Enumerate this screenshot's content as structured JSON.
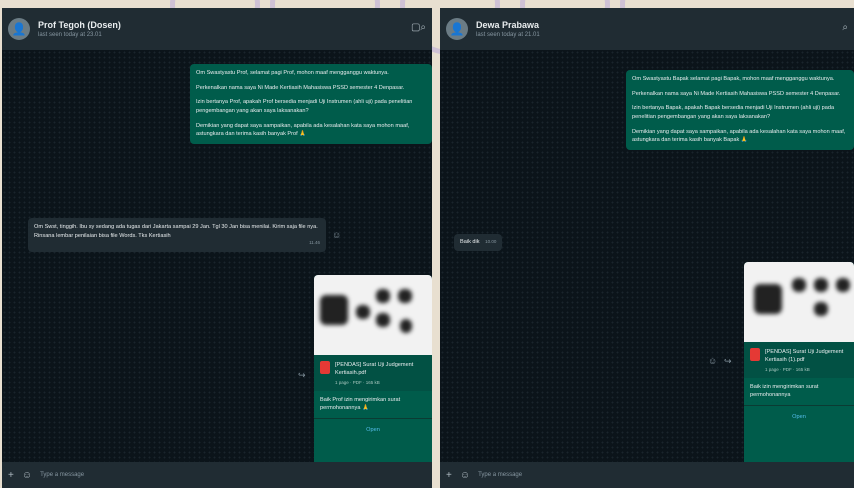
{
  "left": {
    "header": {
      "name": "Prof Tegoh (Dosen)",
      "status": "last seen today at 23.01"
    },
    "outgoing": {
      "p1": "Om Swastyastu Prof, selamat pagi Prof, mohon maaf mengganggu waktunya.",
      "p2": "Perkenalkan nama saya Ni Made Kertiasih Mahasiswa PSSD semester 4 Denpasar.",
      "p3": "Izin bertanya Prof, apakah Prof bersedia menjadi Uji Instrumen (ahli uji) pada penelitian pengembangan yang akan saya laksanakan?",
      "p4": "Demikian yang dapat saya sampaikan, apabila ada kesalahan kata saya mohon maaf, astungkara dan terima kasih banyak Prof 🙏"
    },
    "incoming": {
      "text": "Om Swst, tinggih. Ibu sy sedang ada tugas dari Jakarta sampai 29 Jan. Tgl 30 Jan bisa menilai. Kirim saja file nya. Rinsana lembar penilaian bisa file Words. Tks Kertiasih",
      "time": "11.46"
    },
    "document": {
      "name": "[PENDAS] Surat Uji Judgement Kertiasih.pdf",
      "meta": "1 page · PDF · 165 kB",
      "caption": "Baik Prof izin mengirimkan surat permohonannya 🙏",
      "open": "Open"
    },
    "composer": {
      "placeholder": "Type a message"
    }
  },
  "right": {
    "header": {
      "name": "Dewa Prabawa",
      "status": "last seen today at 21.01"
    },
    "outgoing": {
      "p1": "Om Swastyastu Bapak selamat pagi Bapak, mohon maaf mengganggu waktunya.",
      "p2": "Perkenalkan nama saya Ni Made Kertiasih Mahasiswa PSSD semester 4 Denpasar.",
      "p3": "Izin bertanya Bapak, apakah Bapak bersedia menjadi Uji Instrumen (ahli uji) pada penelitian pengembangan yang akan saya laksanakan?",
      "p4": "Demikian yang dapat saya sampaikan, apabila ada kesalahan kata saya mohon maaf, astungkara dan terima kasih banyak Bapak 🙏"
    },
    "incoming": {
      "text": "Baik dik",
      "time": "10.00"
    },
    "document": {
      "name": "[PENDAS] Surat Uji Judgement Kertiasih (1).pdf",
      "meta": "1 page · PDF · 165 kB",
      "caption": "Baik izin mengirimkan surat permohonannya",
      "open": "Open"
    },
    "composer": {
      "placeholder": "Type a message"
    }
  }
}
